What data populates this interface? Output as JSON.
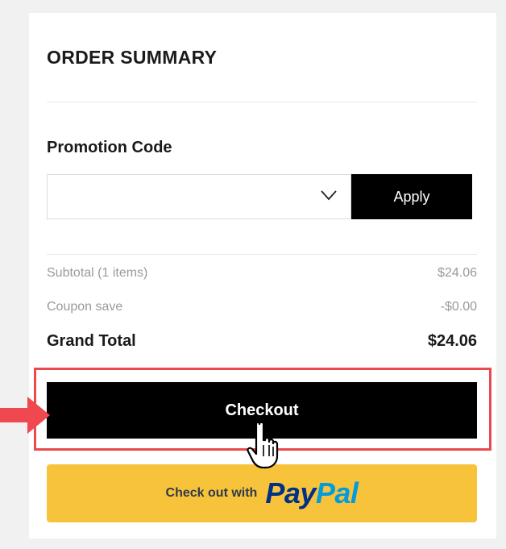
{
  "summary": {
    "title": "ORDER SUMMARY"
  },
  "promo": {
    "label": "Promotion Code",
    "selected_value": "",
    "apply_label": "Apply"
  },
  "totals": {
    "subtotal_label": "Subtotal (1 items)",
    "subtotal_value": "$24.06",
    "coupon_label": "Coupon save",
    "coupon_value": "-$0.00",
    "grand_label": "Grand Total",
    "grand_value": "$24.06"
  },
  "actions": {
    "checkout_label": "Checkout",
    "paypal_prefix": "Check out with",
    "paypal_logo_pay": "Pay",
    "paypal_logo_pal": "Pal"
  },
  "colors": {
    "highlight": "#ea4a4e",
    "paypal_button": "#f7c33b",
    "paypal_dark": "#003087",
    "paypal_light": "#009cde"
  },
  "icons": [
    "chevron-down-icon",
    "pointer-arrow-icon",
    "hand-cursor-icon"
  ]
}
